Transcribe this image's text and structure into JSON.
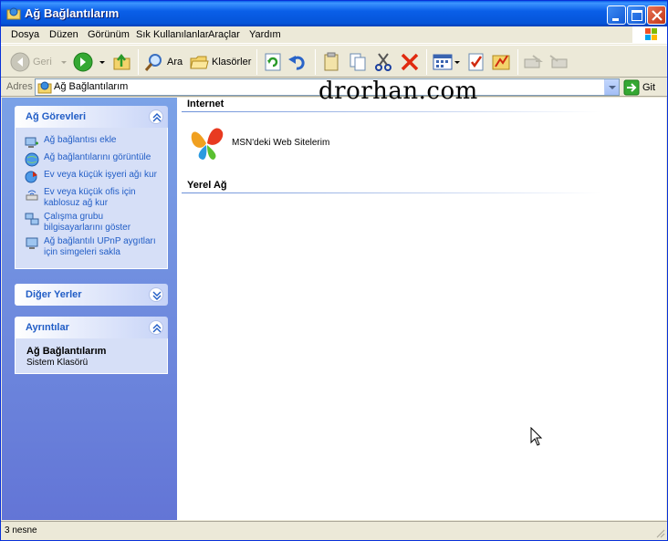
{
  "window": {
    "title": "Ağ Bağlantılarım"
  },
  "menu": {
    "items": [
      "Dosya",
      "Düzen",
      "Görünüm",
      "Sık Kullanılanlar",
      "Araçlar",
      "Yardım"
    ]
  },
  "toolbar": {
    "back_label": "Geri",
    "search_label": "Ara",
    "folders_label": "Klasörler"
  },
  "address": {
    "label": "Adres",
    "value": "Ağ Bağlantılarım",
    "go_label": "Git"
  },
  "tasks_panel": {
    "title": "Ağ Görevleri",
    "items": [
      {
        "label": "Ağ bağlantısı ekle",
        "icon": "add-connection-icon"
      },
      {
        "label": "Ağ bağlantılarını görüntüle",
        "icon": "view-connections-icon"
      },
      {
        "label": "Ev veya küçük işyeri ağı kur",
        "icon": "home-network-icon"
      },
      {
        "label": "Ev veya küçük ofis için kablosuz ağ kur",
        "icon": "wireless-icon"
      },
      {
        "label": "Çalışma grubu bilgisayarlarını göster",
        "icon": "workgroup-icon"
      },
      {
        "label": "Ağ bağlantılı UPnP aygıtları için simgeleri sakla",
        "icon": "upnp-icon"
      }
    ]
  },
  "other_places": {
    "title": "Diğer Yerler"
  },
  "details": {
    "title": "Ayrıntılar",
    "name": "Ağ Bağlantılarım",
    "type": "Sistem Klasörü"
  },
  "content": {
    "group_internet": "Internet",
    "msn_item": "MSN'deki Web Sitelerim",
    "group_local": "Yerel Ağ",
    "watermark": "drorhan.com"
  },
  "status": {
    "text": "3 nesne"
  },
  "colors": {
    "title_blue": "#0a5fe8",
    "link_blue": "#215dc6",
    "pane_blue": "#7ba2e7"
  }
}
